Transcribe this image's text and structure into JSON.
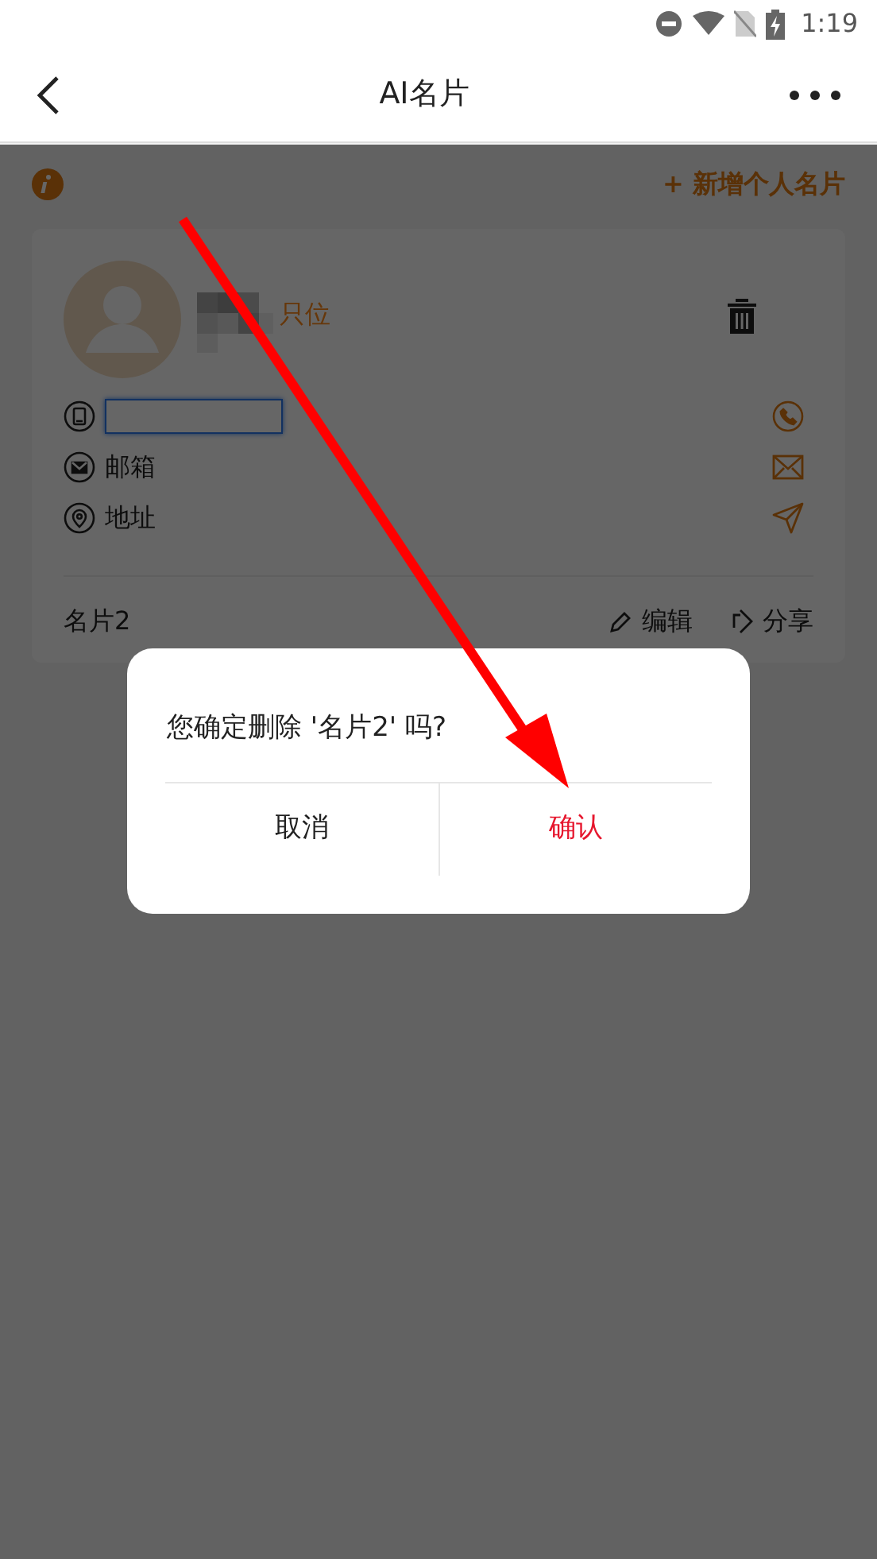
{
  "status_bar": {
    "time": "1:19"
  },
  "header": {
    "title": "AI名片"
  },
  "toolbar": {
    "add_label": "+ 新增个人名片"
  },
  "card": {
    "title_text": "只位",
    "contacts": [
      {
        "kind": "phone"
      },
      {
        "kind": "email",
        "label": "邮箱"
      },
      {
        "kind": "address",
        "label": "地址"
      }
    ],
    "card_name": "名片2",
    "actions": [
      {
        "kind": "edit",
        "label": "编辑"
      },
      {
        "kind": "share",
        "label": "分享"
      }
    ]
  },
  "dialog": {
    "message": "您确定删除 '名片2' 吗?",
    "buttons": [
      {
        "kind": "cancel",
        "label": "取消"
      },
      {
        "kind": "confirm",
        "label": "确认"
      }
    ]
  }
}
